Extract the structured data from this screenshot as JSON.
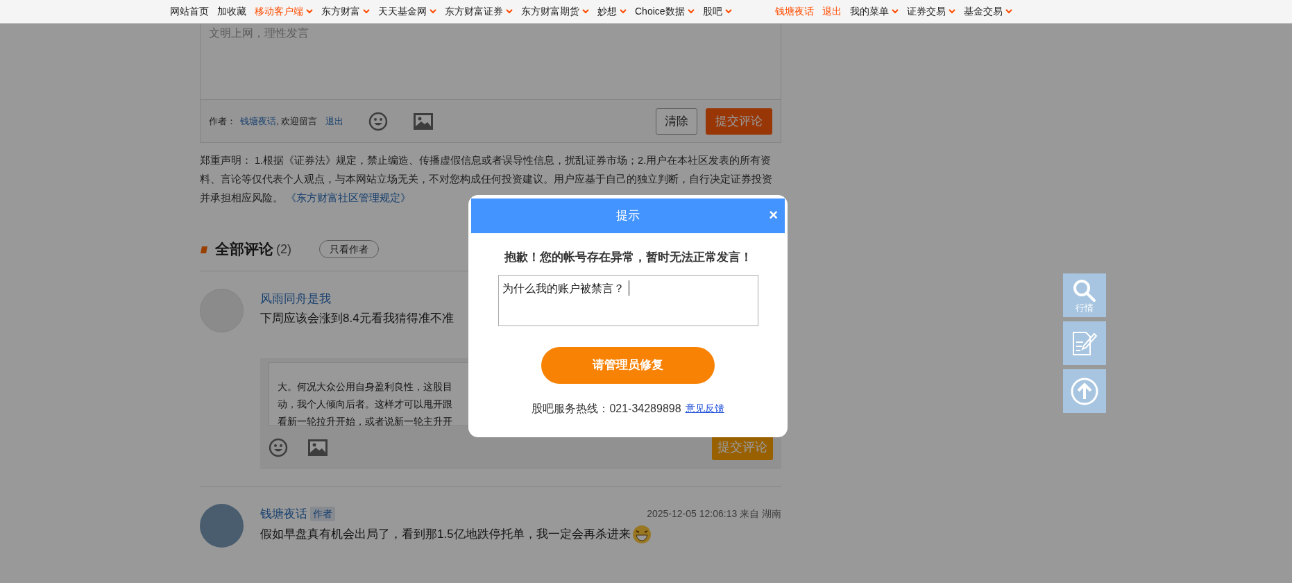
{
  "top_nav": {
    "left": [
      {
        "label": "网站首页",
        "highlight": false,
        "dropdown": false
      },
      {
        "label": "加收藏",
        "highlight": false,
        "dropdown": false
      },
      {
        "label": "移动客户端",
        "highlight": true,
        "dropdown": true
      },
      {
        "label": "东方财富",
        "highlight": false,
        "dropdown": true
      },
      {
        "label": "天天基金网",
        "highlight": false,
        "dropdown": true
      },
      {
        "label": "东方财富证券",
        "highlight": false,
        "dropdown": true
      },
      {
        "label": "东方财富期货",
        "highlight": false,
        "dropdown": true
      },
      {
        "label": "妙想",
        "highlight": false,
        "dropdown": true
      },
      {
        "label": "Choice数据",
        "highlight": false,
        "dropdown": true
      },
      {
        "label": "股吧",
        "highlight": false,
        "dropdown": true
      }
    ],
    "right": [
      {
        "label": "钱塘夜话",
        "highlight": true,
        "dropdown": false
      },
      {
        "label": "退出",
        "highlight": true,
        "dropdown": false
      },
      {
        "label": "我的菜单",
        "highlight": false,
        "dropdown": true
      },
      {
        "label": "证券交易",
        "highlight": false,
        "dropdown": true
      },
      {
        "label": "基金交易",
        "highlight": false,
        "dropdown": true
      }
    ]
  },
  "editor": {
    "placeholder": "文明上网，理性发言",
    "author_label": "作者：",
    "author": "钱塘夜话",
    "welcome": ", 欢迎留言",
    "logout": "退出",
    "clear_button": "清除",
    "submit_button": "提交评论"
  },
  "disclaimer": {
    "text": "郑重声明： 1.根据《证券法》规定，禁止编造、传播虚假信息或者误导性信息，扰乱证券市场；2.用户在本社区发表的所有资料、言论等仅代表个人观点，与本网站立场无关，不对您构成任何投资建议。用户应基于自己的独立判断，自行决定证券投资并承担相应风险。",
    "link": "《东方财富社区管理规定》"
  },
  "comments_header": {
    "title": "全部评论",
    "count": "(2)",
    "filter_button": "只看作者"
  },
  "comments": [
    {
      "user": "风雨同舟是我",
      "is_author": false,
      "text": "下周应该会涨到8.4元看我猜得准不准",
      "reply_box": {
        "lines": [
          "大。何况大众公用自身盈利良性，这股目",
          "动，我个人倾向后者。这样才可以甩开跟",
          "看新一轮拉升开始，或者说新一轮主升开"
        ],
        "submit_button": "提交评论"
      }
    },
    {
      "user": "钱塘夜话",
      "is_author": true,
      "author_badge": "作者",
      "time": "2025-12-05 12:06:13 来自 湖南",
      "text": "假如早盘真有机会出局了，看到那1.5亿地跌停托单，我一定会再杀进来",
      "emoji": true
    }
  ],
  "dialog": {
    "title": "提示",
    "close": "×",
    "message": "抱歉！您的帐号存在异常，暂时无法正常发言！",
    "input_value": "为什么我的账户被禁言？",
    "button": "请管理员修复",
    "hotline": "股吧服务热线：021-34289898",
    "feedback_link": "意见反馈"
  },
  "float_tools": [
    {
      "kind": "search",
      "label": "行情"
    },
    {
      "kind": "edit"
    },
    {
      "kind": "top"
    }
  ]
}
